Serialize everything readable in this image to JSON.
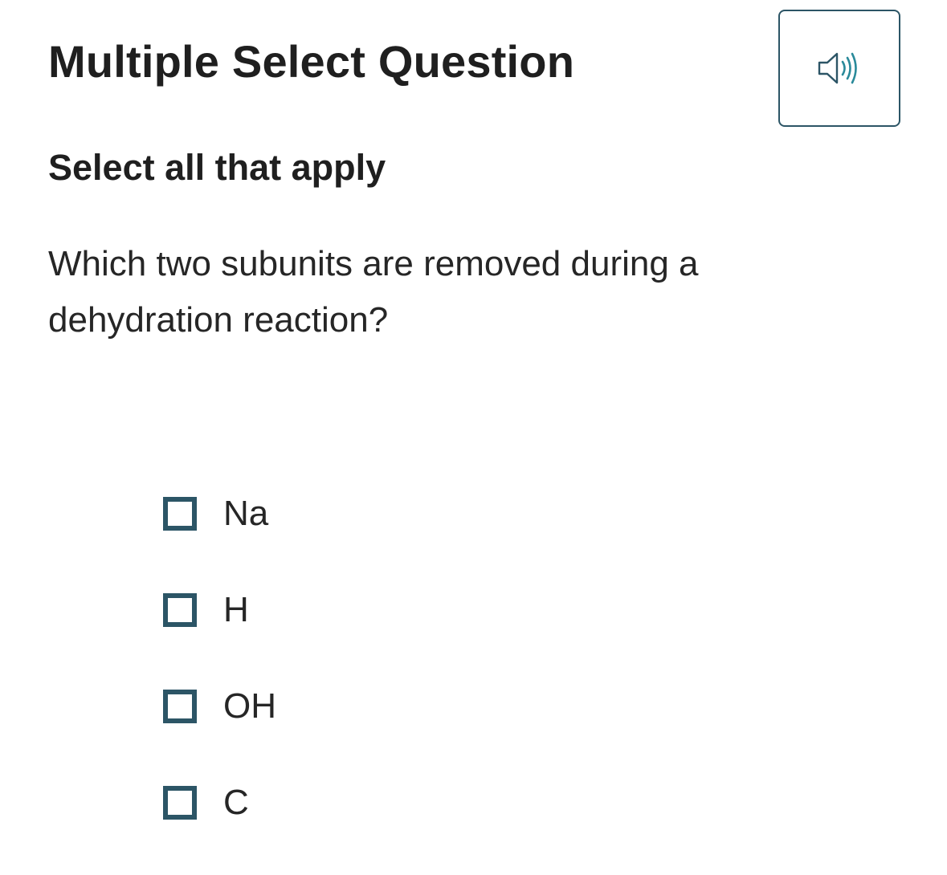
{
  "header": {
    "title": "Multiple Select Question"
  },
  "audio_button": {
    "icon": "speaker-icon",
    "accent_color": "#2a8a9a",
    "border_color": "#2c5566"
  },
  "question": {
    "instruction": "Select all that apply",
    "prompt": "Which two subunits are removed during a dehydration reaction?"
  },
  "options": [
    {
      "label": "Na",
      "checked": false
    },
    {
      "label": "H",
      "checked": false
    },
    {
      "label": "OH",
      "checked": false
    },
    {
      "label": "C",
      "checked": false
    }
  ]
}
